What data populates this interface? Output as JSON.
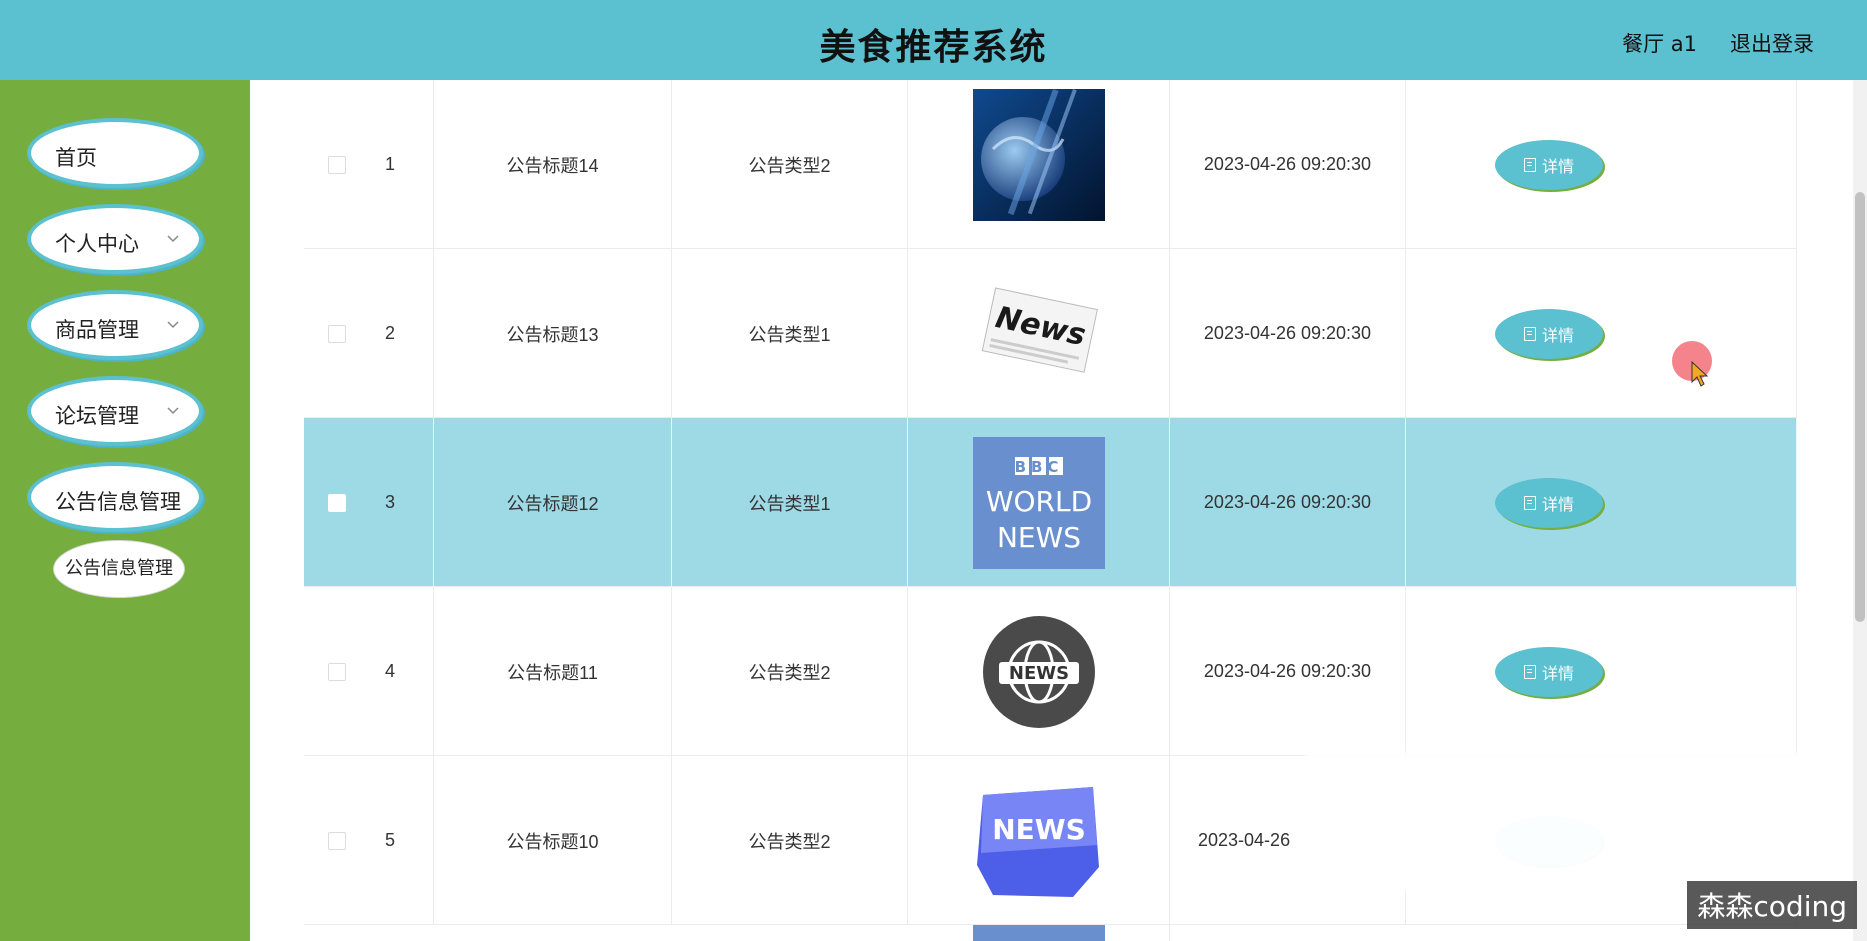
{
  "header": {
    "title": "美食推荐系统",
    "user_label": "餐厅 a1",
    "logout_label": "退出登录"
  },
  "sidebar": {
    "items": [
      {
        "label": "首页",
        "has_chevron": false
      },
      {
        "label": "个人中心",
        "has_chevron": true
      },
      {
        "label": "商品管理",
        "has_chevron": true
      },
      {
        "label": "论坛管理",
        "has_chevron": true
      },
      {
        "label": "公告信息管理",
        "has_chevron": false
      }
    ],
    "subitem": {
      "label": "公告信息管理"
    }
  },
  "table": {
    "detail_label": "详情",
    "rows": [
      {
        "index": "1",
        "title": "公告标题14",
        "type": "公告类型2",
        "image": "globe-news-image",
        "time": "2023-04-26 09:20:30",
        "selected": false
      },
      {
        "index": "2",
        "title": "公告标题13",
        "type": "公告类型1",
        "image": "newspaper-news-image",
        "time": "2023-04-26 09:20:30",
        "selected": false
      },
      {
        "index": "3",
        "title": "公告标题12",
        "type": "公告类型1",
        "image": "bbc-world-news-image",
        "time": "2023-04-26 09:20:30",
        "selected": true
      },
      {
        "index": "4",
        "title": "公告标题11",
        "type": "公告类型2",
        "image": "news-globe-badge-image",
        "time": "2023-04-26 09:20:30",
        "selected": false
      },
      {
        "index": "5",
        "title": "公告标题10",
        "type": "公告类型2",
        "image": "news-keyboard-key-image",
        "time": "2023-04-26",
        "selected": false
      }
    ],
    "image_text": {
      "news": "News",
      "bbc": "BBC",
      "world": "WORLD",
      "news_caps": "NEWS"
    }
  },
  "watermark": "森森coding",
  "colors": {
    "header_bg": "#5bc0cf",
    "sidebar_bg": "#75ad3e",
    "selected_row": "#9edae6",
    "button_bg": "#5bc0cf"
  }
}
